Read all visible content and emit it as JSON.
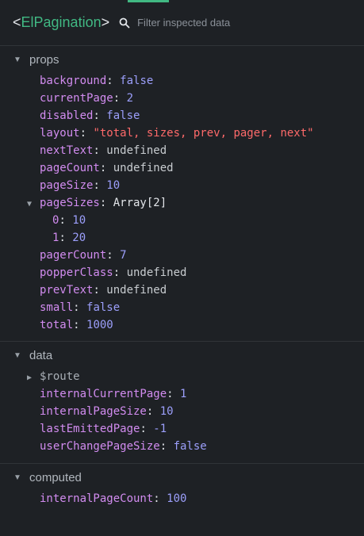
{
  "header": {
    "component_open": "<",
    "component_name": "ElPagination",
    "component_close": ">",
    "search_placeholder": "Filter inspected data",
    "accent_color": "#41b883"
  },
  "props": {
    "title": "props",
    "rows": [
      {
        "key": "background",
        "sep": ": ",
        "value": "false"
      },
      {
        "key": "currentPage",
        "sep": ": ",
        "value": "2"
      },
      {
        "key": "disabled",
        "sep": ": ",
        "value": "false"
      },
      {
        "key": "layout",
        "sep": ": ",
        "value": "\"total, sizes, prev, pager, next\""
      },
      {
        "key": "nextText",
        "sep": ": ",
        "value": "undefined"
      },
      {
        "key": "pageCount",
        "sep": ": ",
        "value": "undefined"
      },
      {
        "key": "pageSize",
        "sep": ": ",
        "value": "10"
      },
      {
        "key": "pageSizes",
        "sep": ": ",
        "value": "Array[2]"
      },
      {
        "key": "0",
        "sep": ": ",
        "value": "10"
      },
      {
        "key": "1",
        "sep": ": ",
        "value": "20"
      },
      {
        "key": "pagerCount",
        "sep": ": ",
        "value": "7"
      },
      {
        "key": "popperClass",
        "sep": ": ",
        "value": "undefined"
      },
      {
        "key": "prevText",
        "sep": ": ",
        "value": "undefined"
      },
      {
        "key": "small",
        "sep": ": ",
        "value": "false"
      },
      {
        "key": "total",
        "sep": ": ",
        "value": "1000"
      }
    ]
  },
  "data": {
    "title": "data",
    "rows": [
      {
        "key": "$route",
        "sep": "",
        "value": ""
      },
      {
        "key": "internalCurrentPage",
        "sep": ": ",
        "value": "1"
      },
      {
        "key": "internalPageSize",
        "sep": ": ",
        "value": "10"
      },
      {
        "key": "lastEmittedPage",
        "sep": ": ",
        "value": "-1"
      },
      {
        "key": "userChangePageSize",
        "sep": ": ",
        "value": "false"
      }
    ]
  },
  "computed": {
    "title": "computed",
    "rows": [
      {
        "key": "internalPageCount",
        "sep": ": ",
        "value": "100"
      }
    ]
  },
  "icons": {
    "search": "search-icon",
    "expand": "caret-down-icon",
    "collapsed": "caret-right-icon"
  }
}
